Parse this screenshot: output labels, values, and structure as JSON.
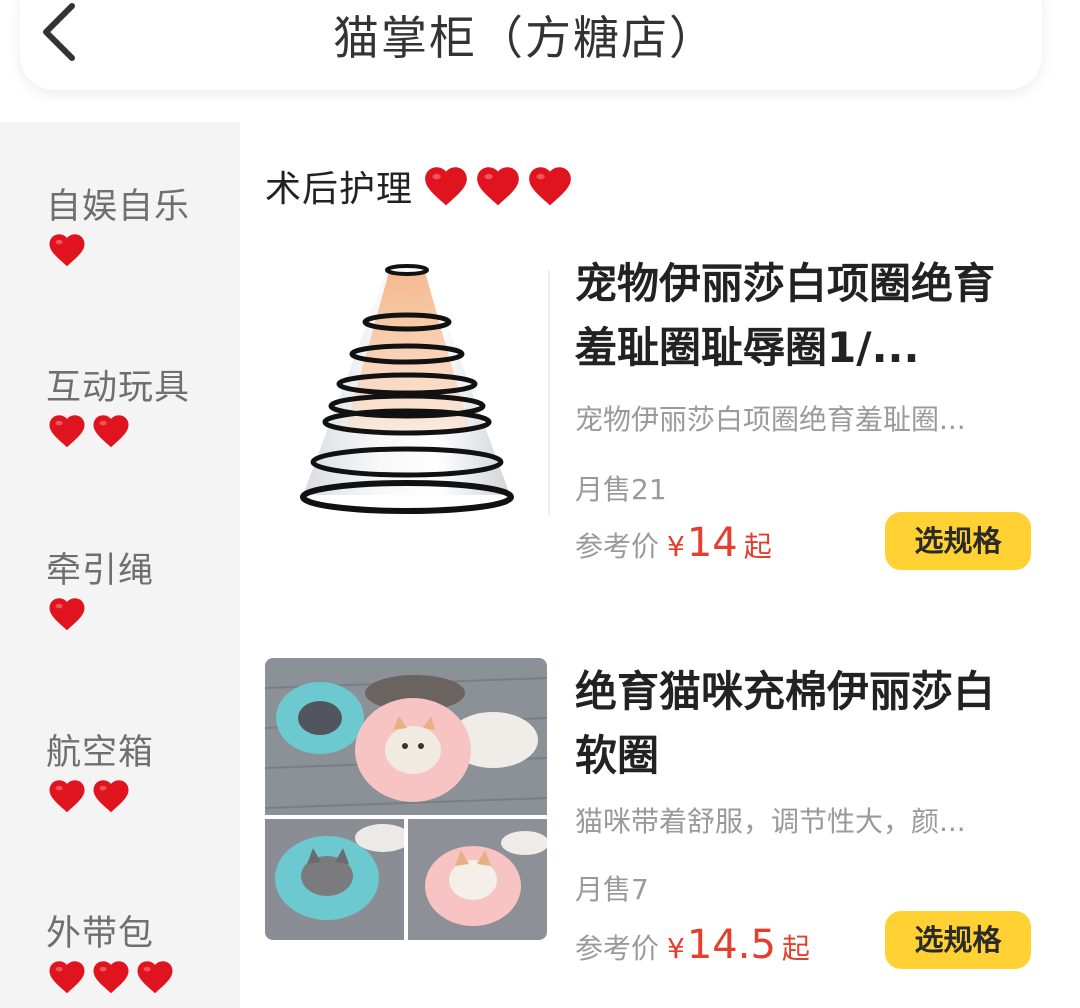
{
  "header": {
    "title": "猫掌柜（方糖店）",
    "back_icon": "chevron-left-icon"
  },
  "sidebar": {
    "items": [
      {
        "label": "自娱自乐",
        "hearts": 1
      },
      {
        "label": "互动玩具",
        "hearts": 2
      },
      {
        "label": "牵引绳",
        "hearts": 1
      },
      {
        "label": "航空箱",
        "hearts": 2
      },
      {
        "label": "外带包",
        "hearts": 3
      }
    ]
  },
  "section": {
    "title": "术后护理",
    "hearts": 3
  },
  "products": [
    {
      "name": "宠物伊丽莎白项圈绝育羞耻圈耻辱圈1/...",
      "desc": "宠物伊丽莎白项圈绝育羞耻圈...",
      "sales": "月售21",
      "price_label": "参考价",
      "currency": "¥",
      "price": "14",
      "price_suffix": "起",
      "button": "选规格",
      "image": "cone-collar"
    },
    {
      "name": "绝育猫咪充棉伊丽莎白软圈",
      "desc": "猫咪带着舒服，调节性大，颜...",
      "sales": "月售7",
      "price_label": "参考价",
      "currency": "¥",
      "price": "14.5",
      "price_suffix": "起",
      "button": "选规格",
      "image": "cat-collar-collage"
    }
  ],
  "colors": {
    "accent_button": "#ffd132",
    "price": "#e53e2d",
    "heart": "#e0141e",
    "sidebar_bg": "#f4f4f4"
  }
}
